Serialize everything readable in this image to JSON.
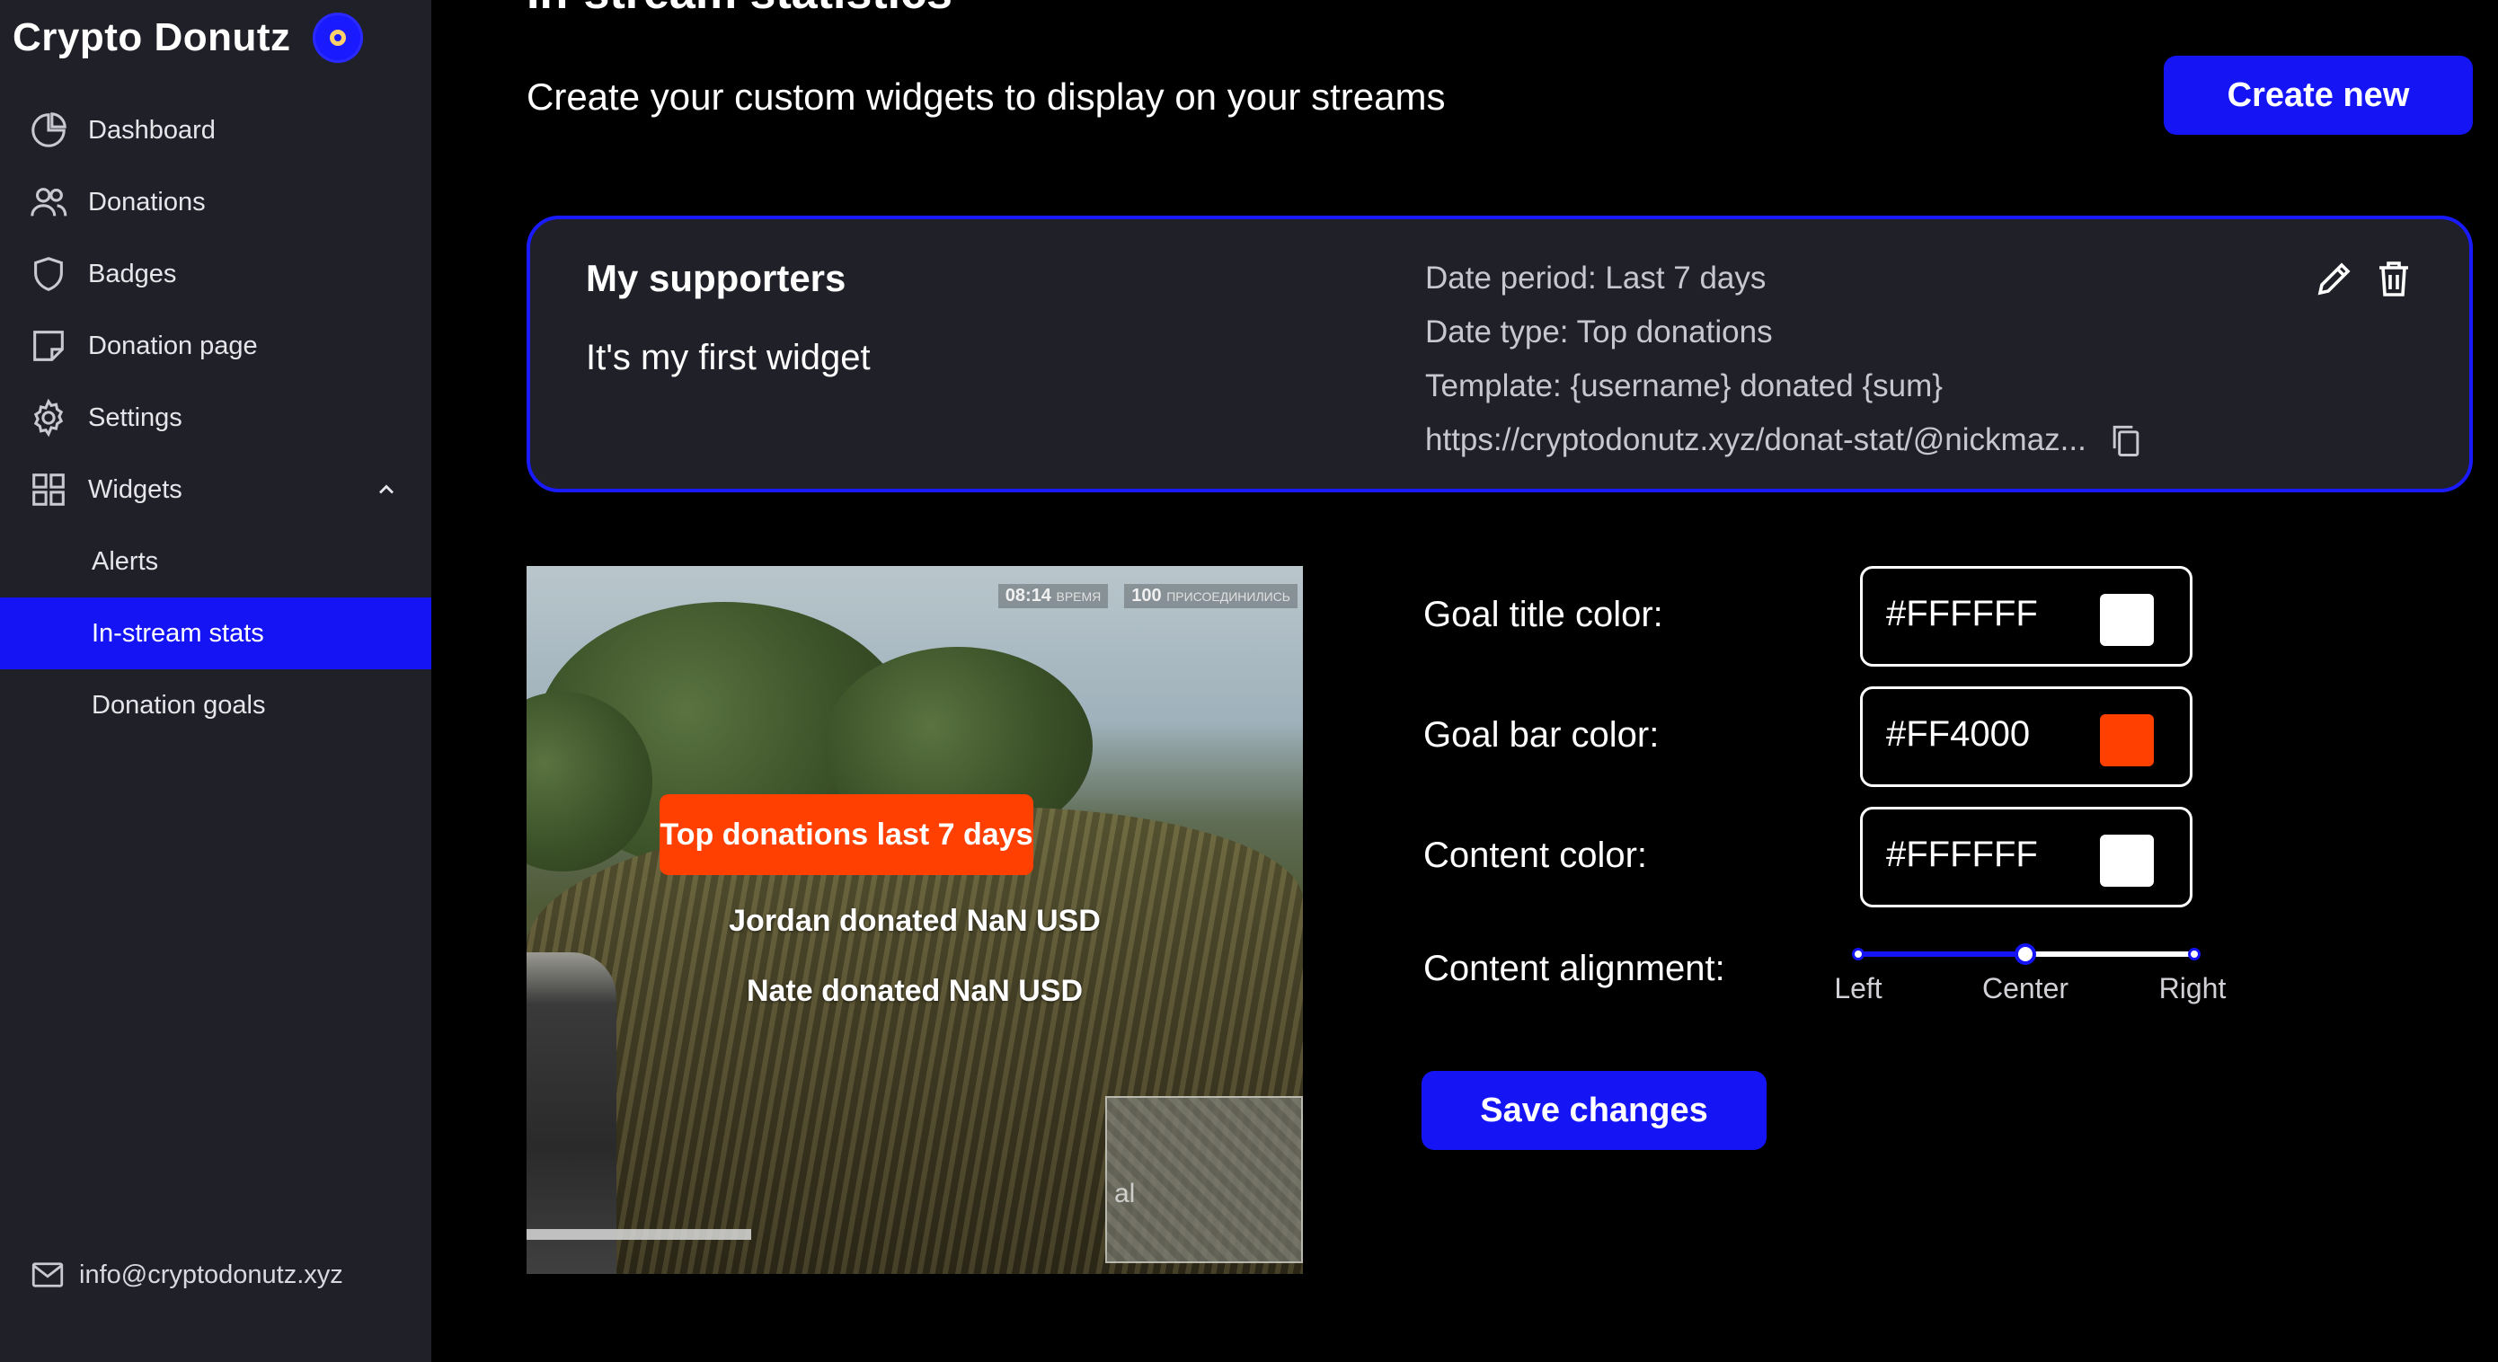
{
  "sidebar": {
    "brand": "Crypto Donutz",
    "items": [
      {
        "label": "Dashboard",
        "icon": "pie-chart-icon"
      },
      {
        "label": "Donations",
        "icon": "users-icon"
      },
      {
        "label": "Badges",
        "icon": "shield-icon"
      },
      {
        "label": "Donation page",
        "icon": "sticky-note-icon"
      },
      {
        "label": "Settings",
        "icon": "gear-icon"
      },
      {
        "label": "Widgets",
        "icon": "grid-icon",
        "expanded": true
      }
    ],
    "subitems": [
      {
        "label": "Alerts",
        "active": false
      },
      {
        "label": "In-stream stats",
        "active": true
      },
      {
        "label": "Donation goals",
        "active": false
      }
    ],
    "footer_email": "info@cryptodonutz.xyz"
  },
  "header": {
    "title": "In-stream statistics",
    "subtitle": "Create your custom widgets to display on your streams",
    "create_label": "Create new"
  },
  "widget": {
    "name": "My supporters",
    "description": "It's my first widget",
    "date_period": "Date period: Last 7 days",
    "date_type": "Date type: Top donations",
    "template": "Template: {username} donated {sum}",
    "url": "https://cryptodonutz.xyz/donat-stat/@nickmaz..."
  },
  "preview": {
    "hud_time": "08:14",
    "hud_time_label": "ВРЕМЯ",
    "hud_count": "100",
    "hud_count_label": "ПРИСОЕДИНИЛИСЬ",
    "title": "Top donations last 7 days",
    "lines": [
      "Jordan donated NaN USD",
      "Nate donated NaN USD"
    ]
  },
  "settings": {
    "goal_title_color_label": "Goal title color:",
    "goal_title_color": "#FFFFFF",
    "goal_bar_color_label": "Goal bar color:",
    "goal_bar_color": "#FF4000",
    "content_color_label": "Content color:",
    "content_color": "#FFFFFF",
    "alignment_label": "Content alignment:",
    "alignment_options": [
      "Left",
      "Center",
      "Right"
    ],
    "alignment_value": "Center",
    "save_label": "Save changes"
  },
  "colors": {
    "accent": "#1414F5",
    "sidebar_bg": "#202028",
    "card_bg": "#202028",
    "goal_bar": "#FF4000"
  }
}
